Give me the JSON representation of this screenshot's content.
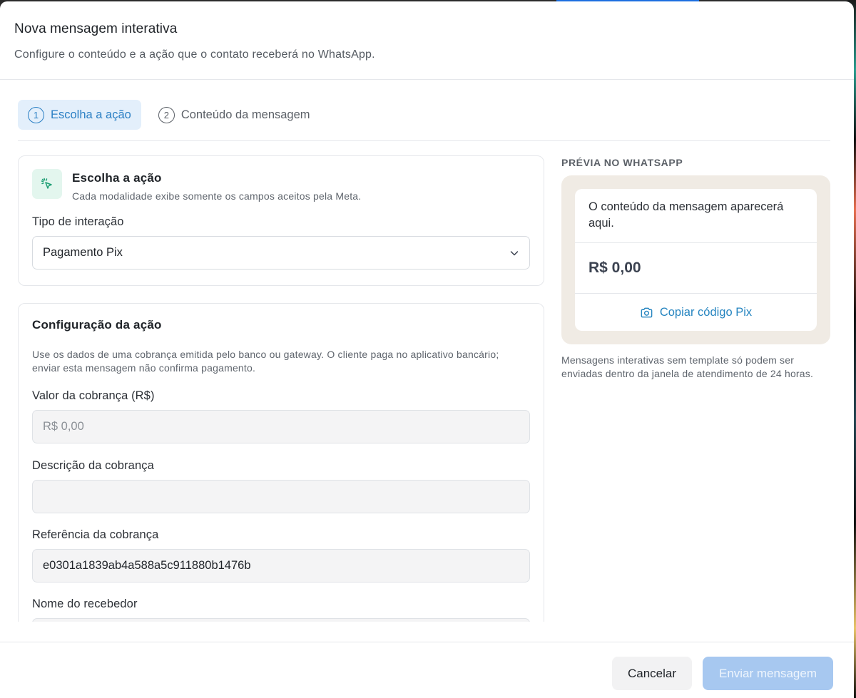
{
  "modal": {
    "title": "Nova mensagem interativa",
    "subtitle": "Configure o conteúdo e a ação que o contato receberá no WhatsApp."
  },
  "stepper": {
    "steps": [
      {
        "number": "1",
        "label": "Escolha a ação",
        "active": true
      },
      {
        "number": "2",
        "label": "Conteúdo da mensagem",
        "active": false
      }
    ]
  },
  "action_card": {
    "icon": "pointer-click-icon",
    "title": "Escolha a ação",
    "description": "Cada modalidade exibe somente os campos aceitos pela Meta.",
    "interaction_label": "Tipo de interação",
    "interaction_value": "Pagamento Pix"
  },
  "config_card": {
    "title": "Configuração da ação",
    "description": "Use os dados de uma cobrança emitida pelo banco ou gateway. O cliente paga no aplicativo bancário; enviar esta mensagem não confirma pagamento.",
    "fields": {
      "amount": {
        "label": "Valor da cobrança (R$)",
        "placeholder": "R$ 0,00",
        "value": ""
      },
      "description": {
        "label": "Descrição da cobrança",
        "value": ""
      },
      "reference": {
        "label": "Referência da cobrança",
        "value": "e0301a1839ab4a588a5c911880b1476b"
      },
      "receiver": {
        "label": "Nome do recebedor",
        "value": ""
      }
    }
  },
  "preview": {
    "title": "PRÉVIA NO WHATSAPP",
    "message_placeholder": "O conteúdo da mensagem aparecerá aqui.",
    "amount": "R$ 0,00",
    "copy_action": "Copiar código Pix",
    "copy_icon": "camera-icon",
    "note": "Mensagens interativas sem template só podem ser enviadas dentro da janela de atendimento de 24 horas."
  },
  "footer": {
    "cancel_label": "Cancelar",
    "send_label": "Enviar mensagem"
  },
  "colors": {
    "accent": "#2a7fc4",
    "step_active_bg": "#e3effb",
    "icon_bg": "#e3f6ee",
    "icon_color": "#1e9e74",
    "preview_bg": "#f0ebe4",
    "send_disabled": "#a7c8f0"
  }
}
